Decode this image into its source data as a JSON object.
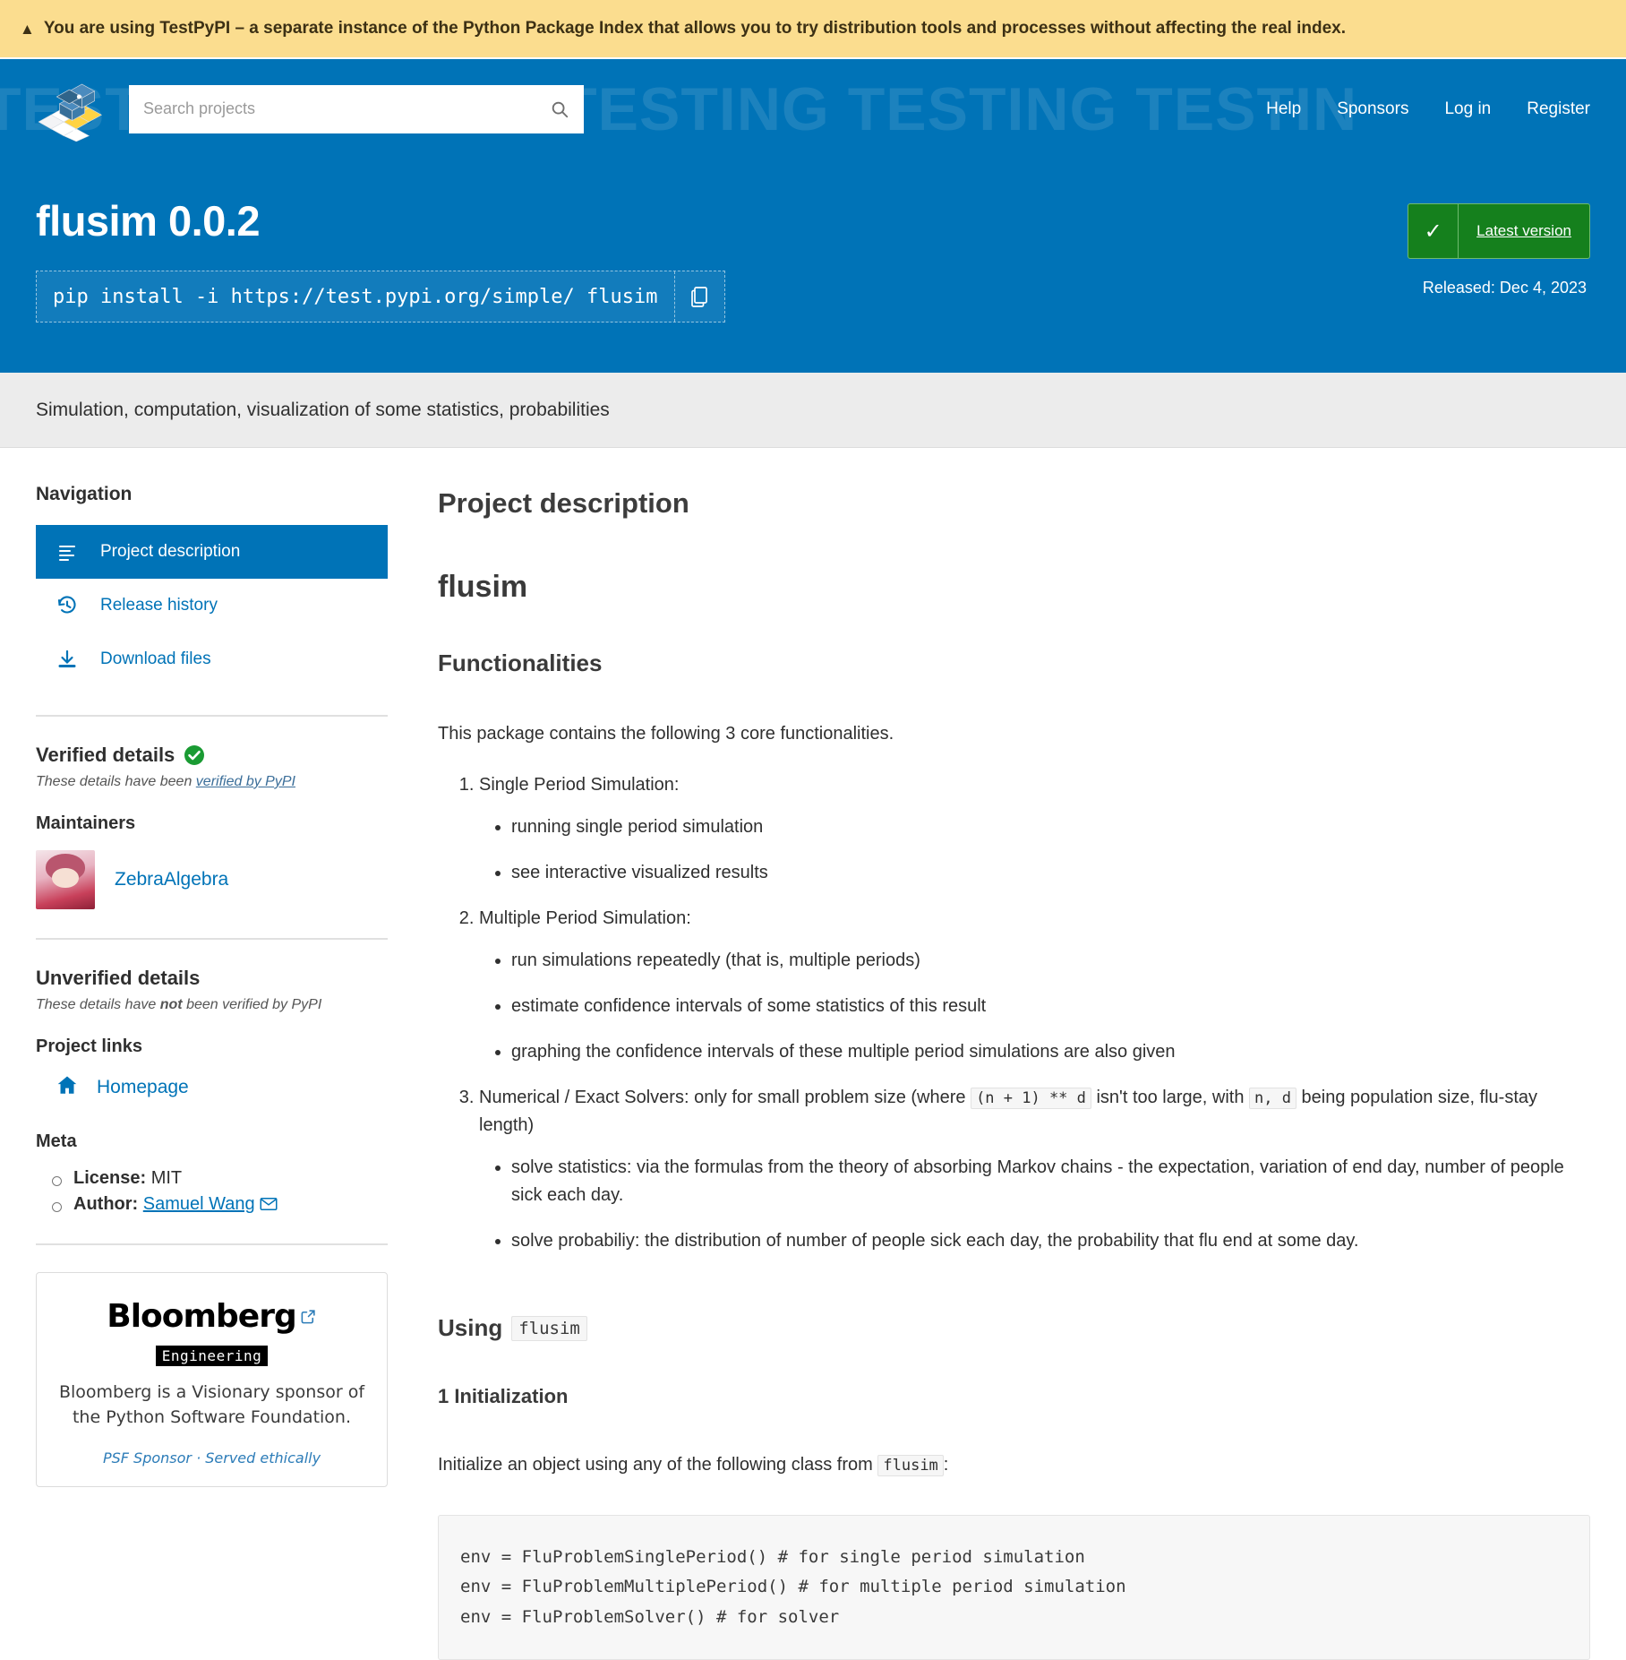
{
  "banner": {
    "icon": "warning-triangle-icon",
    "text": "You are using TestPyPI – a separate instance of the Python Package Index that allows you to try distribution tools and processes without affecting the real index."
  },
  "header": {
    "logo_name": "pypi-logo",
    "watermark": "TESTING TESTING TESTING TESTING TESTIN",
    "search": {
      "placeholder": "Search projects",
      "value": "",
      "icon": "search-icon"
    },
    "nav": [
      {
        "label": "Help"
      },
      {
        "label": "Sponsors"
      },
      {
        "label": "Log in"
      },
      {
        "label": "Register"
      }
    ]
  },
  "package": {
    "title": "flusim 0.0.2",
    "pip_command": "pip install -i https://test.pypi.org/simple/ flusim",
    "copy_icon": "copy-icon",
    "status_badge": {
      "check_icon": "check-icon",
      "label": "Latest version"
    },
    "released": "Released: Dec 4, 2023",
    "summary": "Simulation, computation, visualization of some statistics, probabilities",
    "accent_color": "#0073b7",
    "badge_color": "#15801d"
  },
  "sidebar": {
    "nav_heading": "Navigation",
    "nav_items": [
      {
        "label": "Project description",
        "icon": "list-lines-icon",
        "active": true
      },
      {
        "label": "Release history",
        "icon": "history-clock-icon",
        "active": false
      },
      {
        "label": "Download files",
        "icon": "download-icon",
        "active": false
      }
    ],
    "verified": {
      "heading": "Verified details",
      "badge_icon": "green-check-circle-icon",
      "note_prefix": "These details have been ",
      "note_link": "verified by PyPI",
      "maintainers_heading": "Maintainers",
      "maintainers": [
        {
          "name": "ZebraAlgebra",
          "avatar": "maintainer-avatar"
        }
      ]
    },
    "unverified": {
      "heading": "Unverified details",
      "note_prefix": "These details have ",
      "note_bold": "not",
      "note_suffix": " been verified by PyPI",
      "project_links_heading": "Project links",
      "project_links": [
        {
          "label": "Homepage",
          "icon": "home-icon"
        }
      ],
      "meta_heading": "Meta",
      "meta": [
        {
          "key": "License:",
          "value": " MIT",
          "link": null,
          "icon": null
        },
        {
          "key": "Author:",
          "value": "",
          "link": "Samuel Wang",
          "icon": "envelope-icon"
        }
      ]
    },
    "sponsor": {
      "logo": "Bloomberg",
      "external_icon": "external-link-icon",
      "tag": "Engineering",
      "text": "Bloomberg is a Visionary sponsor of the Python Software Foundation.",
      "footer": "PSF Sponsor · Served ethically"
    }
  },
  "main": {
    "section_title": "Project description",
    "doc_title": "flusim",
    "functionalities_heading": "Functionalities",
    "intro": "This package contains the following 3 core functionalities.",
    "items": [
      {
        "title": "Single Period Simulation:",
        "bullets": [
          "running single period simulation",
          "see interactive visualized results"
        ]
      },
      {
        "title": "Multiple Period Simulation:",
        "bullets": [
          "run simulations repeatedly (that is, multiple periods)",
          "estimate confidence intervals of some statistics of this result",
          "graphing the confidence intervals of these multiple period simulations are also given"
        ]
      },
      {
        "title_part1": "Numerical / Exact Solvers: only for small problem size (where ",
        "code1": "(n + 1) ** d",
        "title_part2": " isn't too large, with ",
        "code2": "n, d",
        "title_part3": " being population size, flu-stay length)",
        "bullets": [
          "solve statistics: via the formulas from the theory of absorbing Markov chains - the expectation, variation of end day, number of people sick each day.",
          "solve probabiliy: the distribution of number of people sick each day, the probability that flu end at some day."
        ]
      }
    ],
    "using_heading": "Using",
    "using_code": "flusim",
    "init_heading": "1 Initialization",
    "init_text_prefix": "Initialize an object using any of the following class from ",
    "init_code": "flusim",
    "init_text_suffix": ":",
    "code_block": "env = FluProblemSinglePeriod() # for single period simulation\nenv = FluProblemMultiplePeriod() # for multiple period simulation\nenv = FluProblemSolver() # for solver"
  }
}
